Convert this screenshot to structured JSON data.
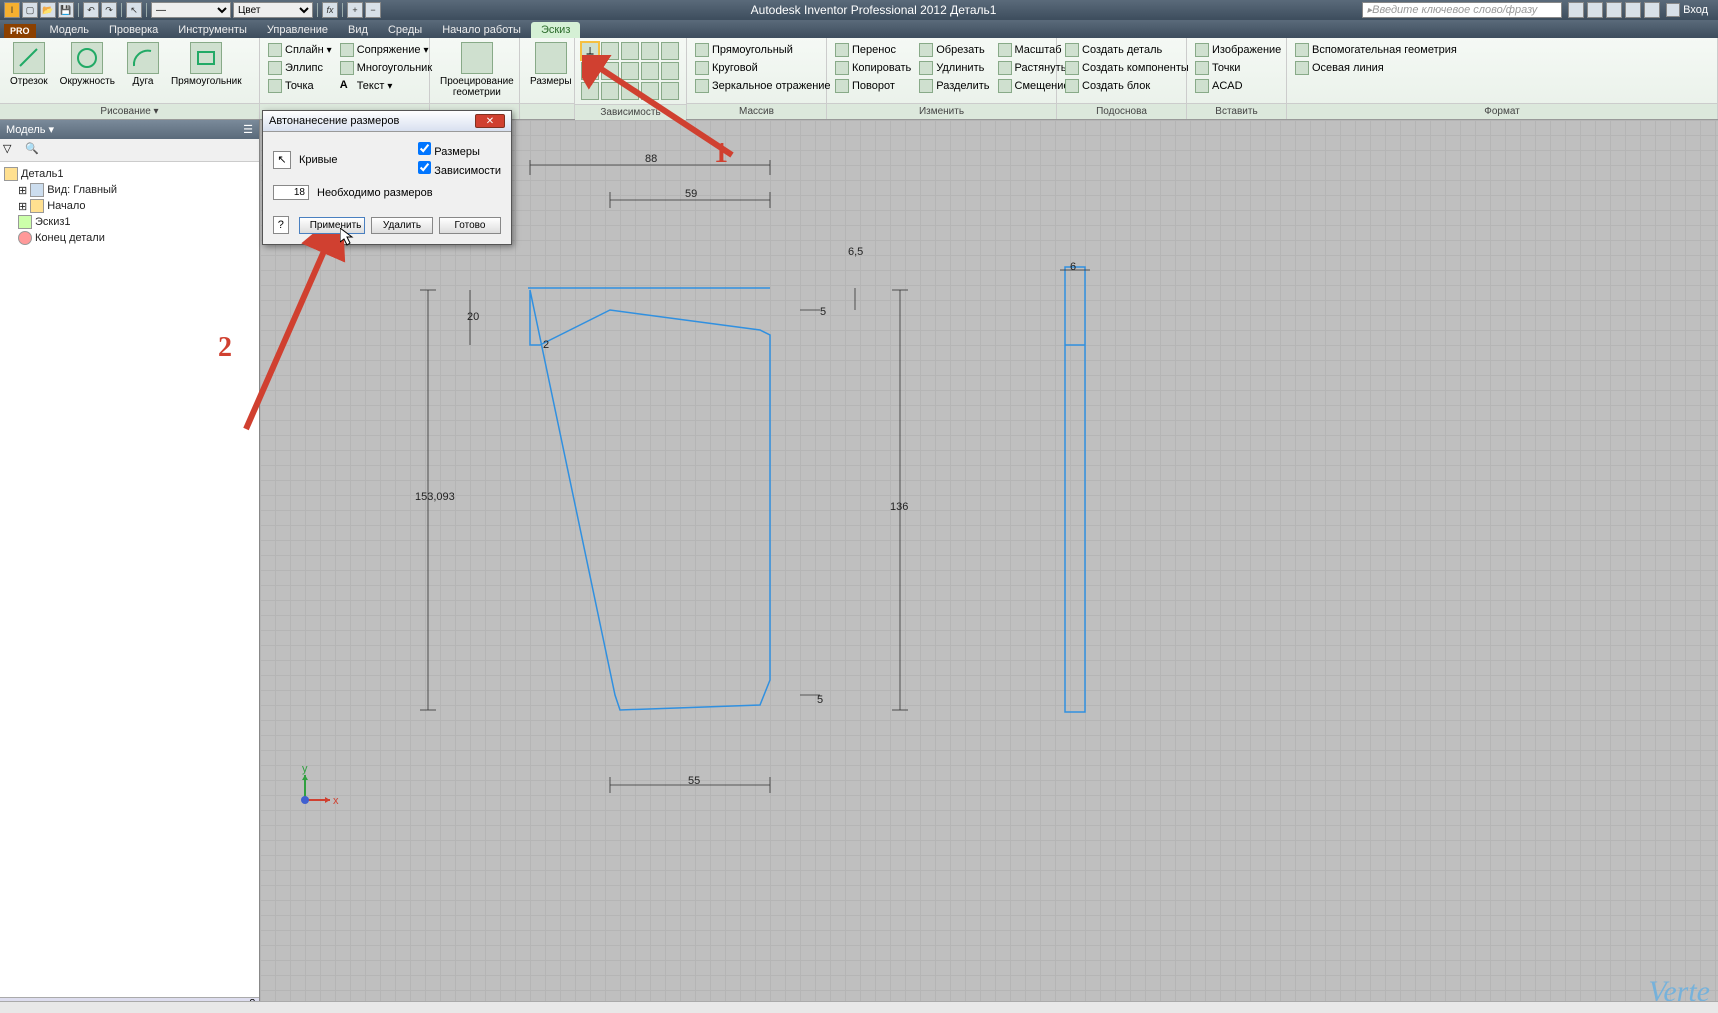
{
  "app": {
    "title": "Autodesk Inventor Professional 2012    Деталь1"
  },
  "qat": {
    "color_dd": "Цвет",
    "search_placeholder": "Введите ключевое слово/фразу",
    "login": "Вход"
  },
  "tabs": {
    "pro": "PRO",
    "items": [
      "Модель",
      "Проверка",
      "Инструменты",
      "Управление",
      "Вид",
      "Среды",
      "Начало работы",
      "Эскиз"
    ],
    "active": "Эскиз"
  },
  "ribbon": {
    "draw": {
      "label": "Рисование ▾",
      "otrezok": "Отрезок",
      "okruzh": "Окружность",
      "duga": "Дуга",
      "pryam": "Прямоугольник",
      "splain": "Сплайн",
      "sopr": "Сопряжение",
      "ellips": "Эллипс",
      "mnogo": "Многоугольник",
      "tochka": "Точка",
      "tekst": "Текст",
      "proek": "Проецирование\nгеометрии"
    },
    "dim": {
      "label": "",
      "razmery": "Размеры"
    },
    "zav": {
      "label": "Зависимость"
    },
    "massiv": {
      "label": "Массив",
      "pryamoug": "Прямоугольный",
      "krug": "Круговой",
      "zerk": "Зеркальное отражение"
    },
    "izm": {
      "label": "Изменить",
      "perenos": "Перенос",
      "kopir": "Копировать",
      "povorot": "Поворот",
      "obrez": "Обрезать",
      "udlin": "Удлинить",
      "razdel": "Разделить",
      "masshtab": "Масштаб",
      "rast": "Растянуть",
      "smesh": "Смещение"
    },
    "podosn": {
      "label": "Подоснова",
      "sozdet": "Создать деталь",
      "sozkomp": "Создать компоненты",
      "sozblok": "Создать блок"
    },
    "vstav": {
      "label": "Вставить",
      "izobr": "Изображение",
      "tochki": "Точки",
      "acad": "ACAD"
    },
    "format": {
      "label": "Формат",
      "vsgeom": "Вспомогательная геометрия",
      "osev": "Осевая линия"
    }
  },
  "model": {
    "hdr": "Модель ▾",
    "root": "Деталь1",
    "items": [
      "Вид: Главный",
      "Начало",
      "Эскиз1",
      "Конец детали"
    ]
  },
  "dialog": {
    "title": "Автонанесение размеров",
    "krivye": "Кривые",
    "razmery": "Размеры",
    "zavis": "Зависимости",
    "num": "18",
    "neobh": "Необходимо размеров",
    "apply": "Применить",
    "del": "Удалить",
    "done": "Готово"
  },
  "dims": {
    "d88": "88",
    "d59": "59",
    "d65": "6,5",
    "d6": "6",
    "d20": "20",
    "d2": "2",
    "d5a": "5",
    "d153": "153,093",
    "d136": "136",
    "d5b": "5",
    "d55": "55"
  },
  "anno": {
    "n1": "1",
    "n2": "2"
  },
  "axes": {
    "x": "x",
    "y": "y"
  },
  "watermark": "Verte"
}
